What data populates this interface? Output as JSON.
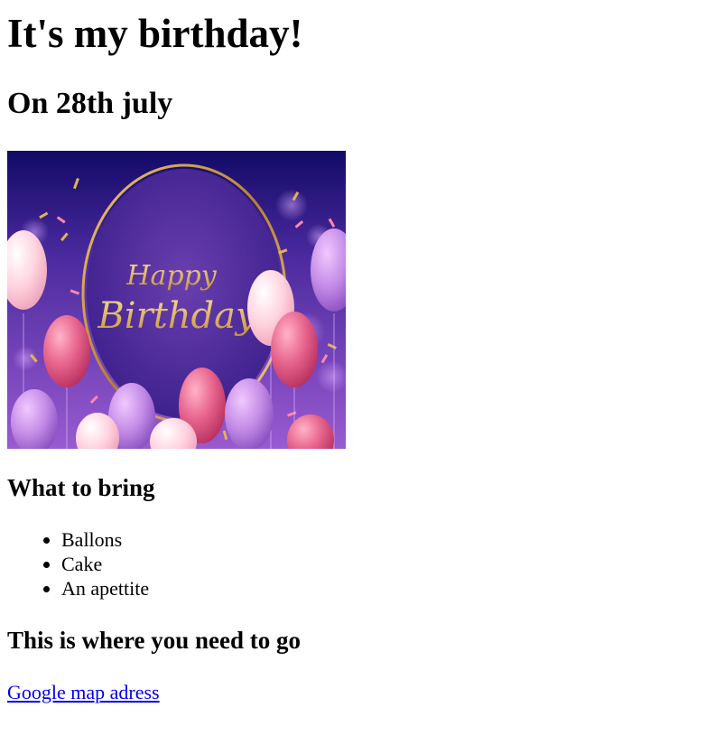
{
  "page": {
    "title": "It's my birthday!",
    "date_heading": "On 28th july"
  },
  "hero_image": {
    "script_line1": "Happy",
    "script_line2": "Birthday",
    "colors": {
      "bg_top": "#1a0f6e",
      "bg_bottom": "#8a4fc7",
      "ring": "#d4a24c",
      "pink": "#e85f8a",
      "light_pink": "#ffc4d6",
      "lavender": "#c78ee6"
    }
  },
  "bring": {
    "heading": "What to bring",
    "items": [
      "Ballons",
      "Cake",
      "An apettite"
    ]
  },
  "location": {
    "heading": "This is where you need to go",
    "link_text": "Google map adress"
  },
  "colors": {
    "link": "#0000ee",
    "text": "#000000"
  }
}
